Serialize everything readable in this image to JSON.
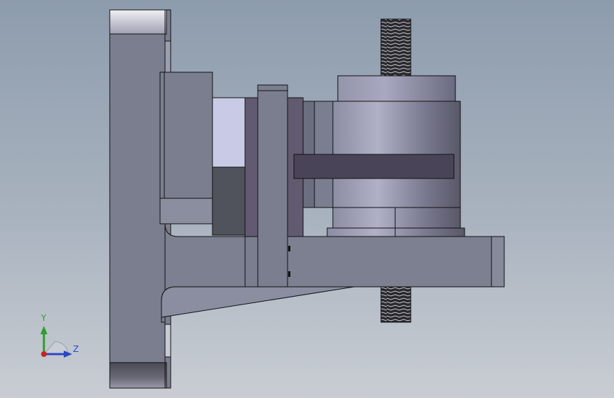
{
  "viewport": {
    "background_top": "#8d9cad",
    "background_bottom": "#c9cdd3"
  },
  "triad": {
    "y_label": "Y",
    "z_label": "Z",
    "colors": {
      "y": "#2aa02a",
      "z": "#2a48c8",
      "x": "#d02020"
    }
  },
  "model": {
    "parts": [
      "mounting-flange",
      "motor-block",
      "vertical-plate",
      "bearing-housing",
      "base-arm",
      "threaded-rod"
    ],
    "colors": {
      "body": "#7a7e8e",
      "body_light": "#cfd1dc",
      "outline": "#111111",
      "cylinder_dark": "#585868",
      "cylinder_light": "#a8a8c0",
      "slot": "#4a4458"
    }
  }
}
